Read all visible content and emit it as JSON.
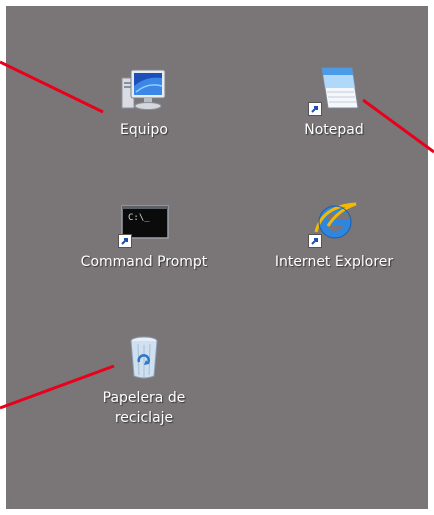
{
  "desktop": {
    "icons": [
      {
        "id": "computer",
        "label": "Equipo",
        "icon": "computer-icon",
        "shortcut": false
      },
      {
        "id": "notepad",
        "label": "Notepad",
        "icon": "notepad-icon",
        "shortcut": true
      },
      {
        "id": "command-prompt",
        "label": "Command Prompt",
        "icon": "command-prompt-icon",
        "shortcut": true,
        "console_text": "C:\\_"
      },
      {
        "id": "internet-explorer",
        "label": "Internet Explorer",
        "icon": "internet-explorer-icon",
        "shortcut": true
      },
      {
        "id": "recycle-bin",
        "label": "Papelera de reciclaje",
        "icon": "recycle-bin-icon",
        "shortcut": false
      }
    ]
  },
  "colors": {
    "desktop_background": "#7a7677",
    "callout_line": "#e8001c",
    "label_text": "#ffffff"
  }
}
